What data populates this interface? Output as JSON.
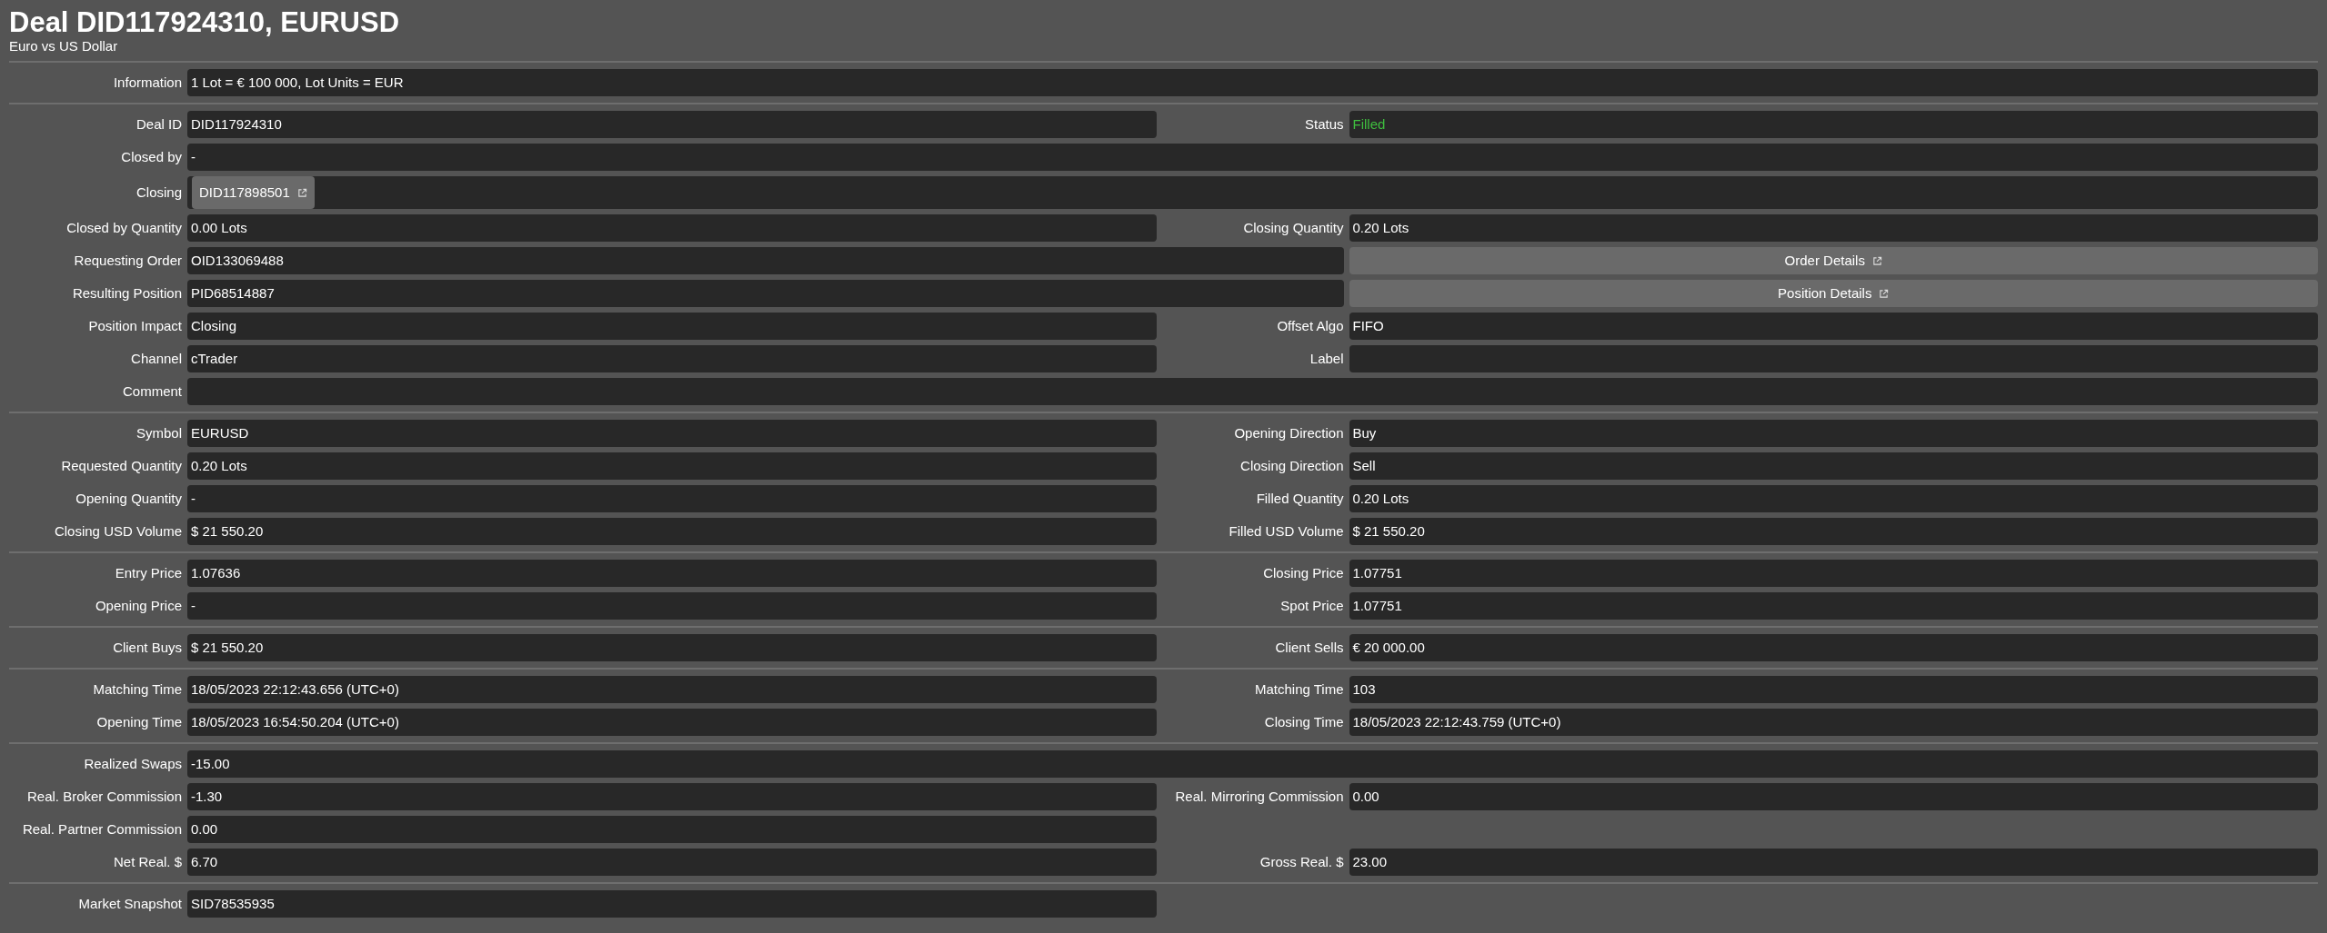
{
  "header": {
    "title": "Deal DID117924310, EURUSD",
    "subtitle": "Euro vs US Dollar"
  },
  "sections": [
    {
      "rows": [
        {
          "kind": "single",
          "label": "Information",
          "value": "1 Lot = € 100 000, Lot Units = EUR"
        }
      ]
    },
    {
      "rows": [
        {
          "kind": "pair",
          "left": {
            "label": "Deal ID",
            "value": "DID117924310"
          },
          "right": {
            "label": "Status",
            "value": "Filled",
            "color": "#3fbf3f"
          }
        },
        {
          "kind": "single",
          "label": "Closed by",
          "value": "-"
        },
        {
          "kind": "chip",
          "label": "Closing",
          "chip": "DID117898501"
        },
        {
          "kind": "pair",
          "left": {
            "label": "Closed by Quantity",
            "value": "0.00 Lots"
          },
          "right": {
            "label": "Closing Quantity",
            "value": "0.20 Lots"
          }
        },
        {
          "kind": "link",
          "label": "Requesting Order",
          "value": "OID133069488",
          "button": "Order Details"
        },
        {
          "kind": "link",
          "label": "Resulting Position",
          "value": "PID68514887",
          "button": "Position Details"
        },
        {
          "kind": "pair",
          "left": {
            "label": "Position Impact",
            "value": "Closing"
          },
          "right": {
            "label": "Offset Algo",
            "value": "FIFO"
          }
        },
        {
          "kind": "pair",
          "left": {
            "label": "Channel",
            "value": "cTrader"
          },
          "right": {
            "label": "Label"
          }
        },
        {
          "kind": "single",
          "label": "Comment"
        }
      ]
    },
    {
      "rows": [
        {
          "kind": "pair",
          "left": {
            "label": "Symbol",
            "value": "EURUSD"
          },
          "right": {
            "label": "Opening Direction",
            "value": "Buy"
          }
        },
        {
          "kind": "pair",
          "left": {
            "label": "Requested Quantity",
            "value": "0.20 Lots"
          },
          "right": {
            "label": "Closing Direction",
            "value": "Sell"
          }
        },
        {
          "kind": "pair",
          "left": {
            "label": "Opening Quantity",
            "value": "-"
          },
          "right": {
            "label": "Filled Quantity",
            "value": "0.20 Lots"
          }
        },
        {
          "kind": "pair",
          "left": {
            "label": "Closing USD Volume",
            "value": "$ 21 550.20"
          },
          "right": {
            "label": "Filled USD Volume",
            "value": "$ 21 550.20"
          }
        }
      ]
    },
    {
      "rows": [
        {
          "kind": "pair",
          "left": {
            "label": "Entry Price",
            "value": "1.07636"
          },
          "right": {
            "label": "Closing Price",
            "value": "1.07751"
          }
        },
        {
          "kind": "pair",
          "left": {
            "label": "Opening Price",
            "value": "-"
          },
          "right": {
            "label": "Spot Price",
            "value": "1.07751"
          }
        }
      ]
    },
    {
      "rows": [
        {
          "kind": "pair",
          "left": {
            "label": "Client Buys",
            "value": "$ 21 550.20"
          },
          "right": {
            "label": "Client Sells",
            "value": "€ 20 000.00"
          }
        }
      ]
    },
    {
      "rows": [
        {
          "kind": "pair",
          "left": {
            "label": "Matching Time",
            "value": "18/05/2023 22:12:43.656 (UTC+0)"
          },
          "right": {
            "label": "Matching Time",
            "value": "103"
          }
        },
        {
          "kind": "pair",
          "left": {
            "label": "Opening Time",
            "value": "18/05/2023 16:54:50.204 (UTC+0)"
          },
          "right": {
            "label": "Closing Time",
            "value": "18/05/2023 22:12:43.759 (UTC+0)"
          }
        }
      ]
    },
    {
      "rows": [
        {
          "kind": "single",
          "label": "Realized Swaps",
          "value": "-15.00"
        },
        {
          "kind": "pair",
          "left": {
            "label": "Real. Broker Commission",
            "value": "-1.30"
          },
          "right": {
            "label": "Real. Mirroring Commission",
            "value": "0.00"
          }
        },
        {
          "kind": "half",
          "label": "Real. Partner Commission",
          "value": "0.00"
        },
        {
          "kind": "pair",
          "left": {
            "label": "Net Real. $",
            "value": "6.70"
          },
          "right": {
            "label": "Gross Real. $",
            "value": "23.00"
          }
        }
      ]
    },
    {
      "rows": [
        {
          "kind": "half",
          "label": "Market Snapshot",
          "value": "SID78535935"
        }
      ]
    }
  ]
}
